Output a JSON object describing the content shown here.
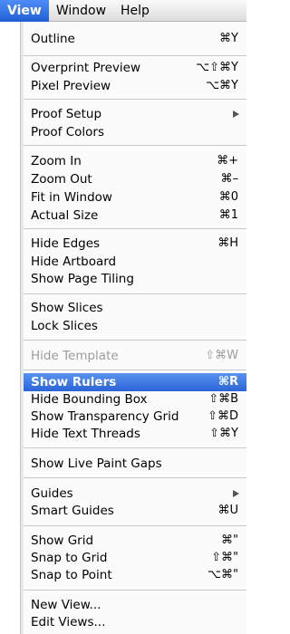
{
  "menubar": {
    "items": [
      {
        "label": "View"
      },
      {
        "label": "Window"
      },
      {
        "label": "Help"
      }
    ]
  },
  "menu": {
    "items": [
      {
        "label": "Outline",
        "shortcut": "⌘Y"
      },
      {
        "label": "Overprint Preview",
        "shortcut": "⌥⇧⌘Y"
      },
      {
        "label": "Pixel Preview",
        "shortcut": "⌥⌘Y"
      },
      {
        "label": "Proof Setup",
        "shortcut": ""
      },
      {
        "label": "Proof Colors",
        "shortcut": ""
      },
      {
        "label": "Zoom In",
        "shortcut": "⌘+"
      },
      {
        "label": "Zoom Out",
        "shortcut": "⌘–"
      },
      {
        "label": "Fit in Window",
        "shortcut": "⌘0"
      },
      {
        "label": "Actual Size",
        "shortcut": "⌘1"
      },
      {
        "label": "Hide Edges",
        "shortcut": "⌘H"
      },
      {
        "label": "Hide Artboard",
        "shortcut": ""
      },
      {
        "label": "Show Page Tiling",
        "shortcut": ""
      },
      {
        "label": "Show Slices",
        "shortcut": ""
      },
      {
        "label": "Lock Slices",
        "shortcut": ""
      },
      {
        "label": "Hide Template",
        "shortcut": "⇧⌘W"
      },
      {
        "label": "Show Rulers",
        "shortcut": "⌘R"
      },
      {
        "label": "Hide Bounding Box",
        "shortcut": "⇧⌘B"
      },
      {
        "label": "Show Transparency Grid",
        "shortcut": "⇧⌘D"
      },
      {
        "label": "Hide Text Threads",
        "shortcut": "⇧⌘Y"
      },
      {
        "label": "Show Live Paint Gaps",
        "shortcut": ""
      },
      {
        "label": "Guides",
        "shortcut": ""
      },
      {
        "label": "Smart Guides",
        "shortcut": "⌘U"
      },
      {
        "label": "Show Grid",
        "shortcut": "⌘\""
      },
      {
        "label": "Snap to Grid",
        "shortcut": "⇧⌘\""
      },
      {
        "label": "Snap to Point",
        "shortcut": "⌥⌘\""
      },
      {
        "label": "New View...",
        "shortcut": ""
      },
      {
        "label": "Edit Views...",
        "shortcut": ""
      }
    ]
  }
}
